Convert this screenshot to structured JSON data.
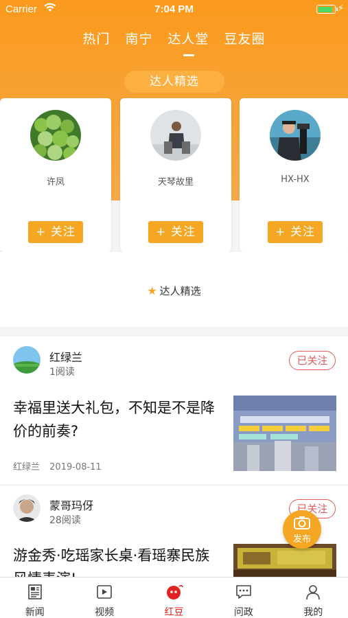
{
  "status_bar": {
    "carrier": "Carrier",
    "time": "7:04 PM"
  },
  "channel_tabs": [
    "热门",
    "南宁",
    "达人堂",
    "豆友圈"
  ],
  "active_channel": "达人堂",
  "section_title": "达人精选",
  "experts": [
    {
      "name": "许凤",
      "follow_label": "+ 关注",
      "avatar": "green-fruit"
    },
    {
      "name": "天琴故里",
      "follow_label": "+ 关注",
      "avatar": "person-sitting"
    },
    {
      "name": "HX-HX",
      "follow_label": "+ 关注",
      "avatar": "person-camera"
    }
  ],
  "featured_label": "达人精选",
  "articles": [
    {
      "author": "红绿兰",
      "reads": "1阅读",
      "follow_status": "已关注",
      "title": "幸福里送大礼包，不知是不是降价的前奏?",
      "meta_author": "红绿兰",
      "date": "2019-08-11"
    },
    {
      "author": "蒙哥玛伢",
      "reads": "28阅读",
      "follow_status": "已关注",
      "title": "游金秀·吃瑶家长桌·看瑶寨民族风情表演!"
    }
  ],
  "fab_label": "发布",
  "bottom_tabs": [
    {
      "label": "新闻",
      "icon": "newspaper-icon"
    },
    {
      "label": "视频",
      "icon": "video-icon"
    },
    {
      "label": "红豆",
      "icon": "red-bean-icon"
    },
    {
      "label": "问政",
      "icon": "chat-icon"
    },
    {
      "label": "我的",
      "icon": "profile-icon"
    }
  ],
  "active_bottom_tab": "红豆",
  "colors": {
    "accent": "#f5a623",
    "header": "#fb9a1d",
    "active_tab": "#e02424",
    "followed": "#e25b5b"
  }
}
